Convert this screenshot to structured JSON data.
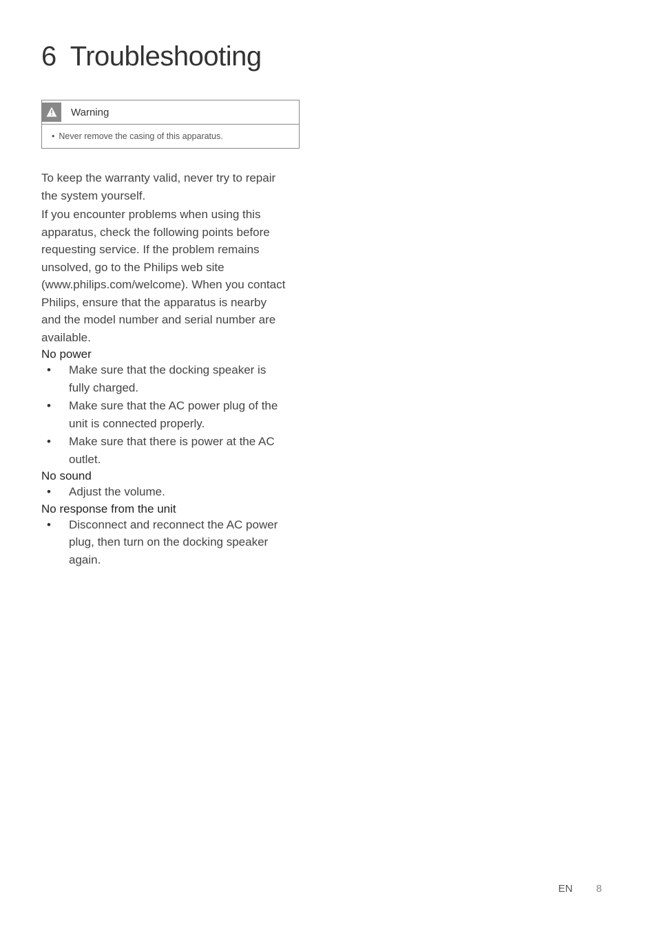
{
  "chapter": {
    "number": "6",
    "title": "Troubleshooting"
  },
  "warning": {
    "label": "Warning",
    "item": "Never remove the casing of this apparatus."
  },
  "intro_para1": "To keep the warranty valid, never try to repair the system yourself.",
  "intro_para2": "If you encounter problems when using this apparatus, check the following points before requesting service. If the problem remains unsolved, go to the Philips web site (www.philips.com/welcome). When you contact Philips, ensure that the apparatus is nearby and the model number and serial number are available.",
  "sections": {
    "no_power": {
      "label": "No power",
      "items": [
        "Make sure that the docking speaker is fully charged.",
        "Make sure that the AC power plug of the unit is connected properly.",
        "Make sure that there is power at the AC outlet."
      ]
    },
    "no_sound": {
      "label": "No sound",
      "items": [
        "Adjust the volume."
      ]
    },
    "no_response": {
      "label": "No response from the unit",
      "items": [
        "Disconnect and reconnect the AC power plug, then turn on the docking speaker again."
      ]
    }
  },
  "footer": {
    "lang": "EN",
    "page": "8"
  }
}
